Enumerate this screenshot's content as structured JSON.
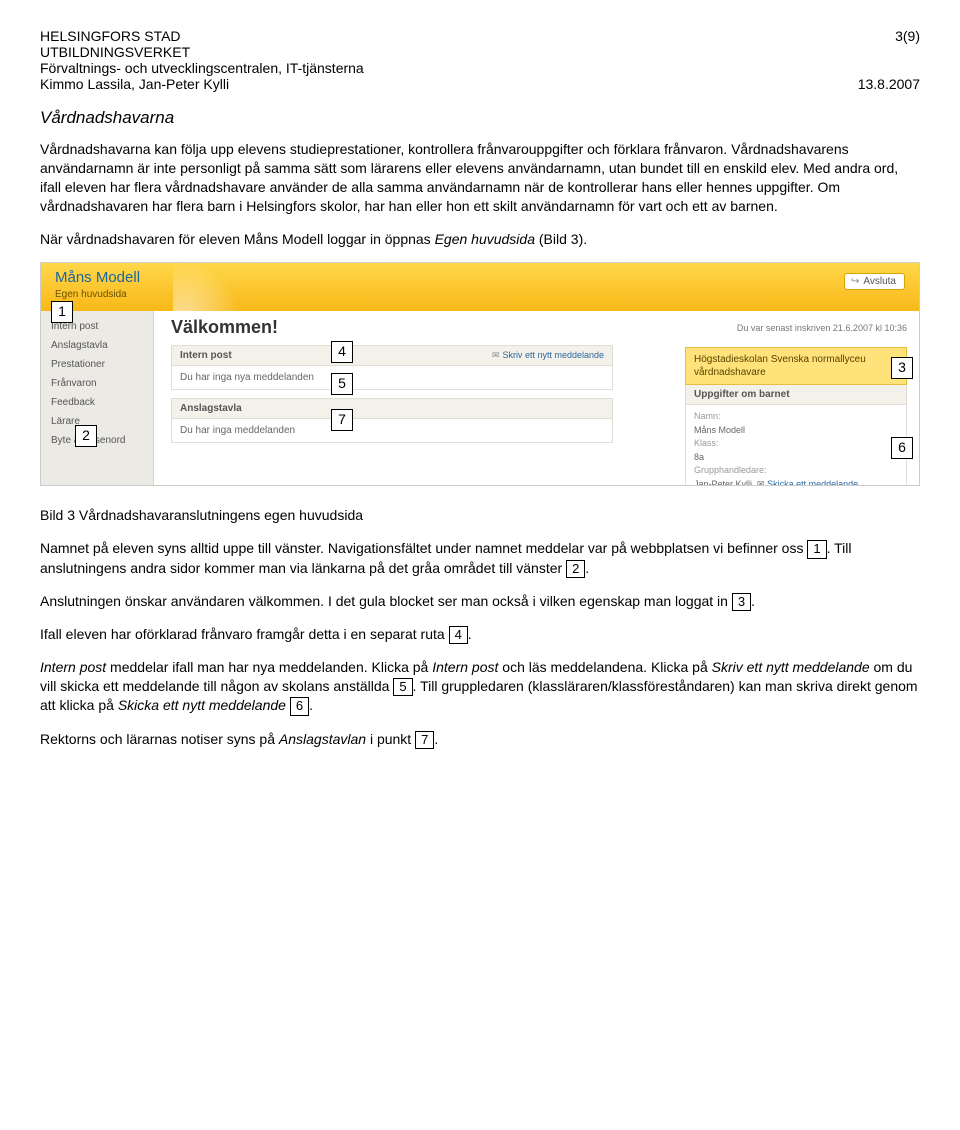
{
  "header": {
    "org1": "HELSINGFORS STAD",
    "org2": "UTBILDNINGSVERKET",
    "org3": "Förvaltnings- och utvecklingscentralen, IT-tjänsterna",
    "authors": "Kimmo Lassila, Jan-Peter Kylli",
    "page": "3(9)",
    "date": "13.8.2007"
  },
  "title": "Vårdnadshavarna",
  "para1a": "Vårdnadshavarna kan följa upp elevens studieprestationer, kontrollera frånvarouppgifter och förklara frånvaron. Vårdnadshavarens användarnamn är inte personligt på samma sätt som lärarens eller elevens användarnamn, utan bundet till en enskild elev. Med andra ord, ifall eleven har flera vårdnadshavare använder de alla samma användarnamn när de kontrollerar hans eller hennes uppgifter. Om vårdnadshavaren har flera barn i Helsingfors skolor, har han eller hon ett skilt användarnamn för vart och ett av barnen.",
  "para2_pre": "När vårdnadshavaren för eleven Måns Modell loggar in öppnas ",
  "para2_em": "Egen huvudsida",
  "para2_post": " (Bild 3).",
  "shot": {
    "name": "Måns Modell",
    "breadcrumb": "Egen huvudsida",
    "avsluta": "Avsluta",
    "welcome": "Välkommen!",
    "lastlogin": "Du var senast inskriven 21.6.2007 kl 10:36",
    "nav": [
      "Intern post",
      "Anslagstavla",
      "Prestationer",
      "Frånvaron",
      "Feedback",
      "Lärare",
      "Byte av lösenord"
    ],
    "mid": {
      "p1_title": "Intern post",
      "p1_link": "Skriv ett nytt meddelande",
      "p1_row": "Du har inga nya meddelanden",
      "p2_title": "Anslagstavla",
      "p2_row": "Du har inga meddelanden"
    },
    "right": {
      "role_line1": "Högstadieskolan Svenska normallyceu",
      "role_line2": "vårdnadshavare",
      "info_title": "Uppgifter om barnet",
      "lbl_name": "Namn:",
      "val_name": "Måns Modell",
      "lbl_class": "Klass:",
      "val_class": "8a",
      "lbl_handler": "Grupphandledare:",
      "val_handler": "Jan-Peter Kylli",
      "msg_link": "Skicka ett meddelande"
    }
  },
  "caption": "Bild 3 Vårdnadshavaranslutningens egen huvudsida",
  "p3_a": "Namnet på eleven syns alltid uppe till vänster. Navigationsfältet under namnet meddelar var på webbplatsen vi befinner oss ",
  "p3_b": ". Till anslutningens andra sidor kommer man via länkarna på det gråa området till vänster ",
  "p3_c": ".",
  "p4_a": "Anslutningen önskar användaren välkommen. I det gula blocket ser man också i vilken egenskap man loggat in ",
  "p4_b": ".",
  "p5_a": "Ifall eleven har oförklarad frånvaro framgår detta i en separat ruta ",
  "p5_b": ".",
  "p6_em1": "Intern post",
  "p6_a": " meddelar ifall man har nya meddelanden. Klicka på ",
  "p6_em2": "Intern post",
  "p6_b": " och läs meddelandena. Klicka på ",
  "p6_em3": "Skriv ett nytt meddelande",
  "p6_c": " om du vill skicka ett meddelande till någon av skolans anställda ",
  "p6_d": ". Till gruppledaren (klassläraren/klassföreståndaren) kan man skriva direkt genom att klicka på ",
  "p6_em4": "Skicka ett nytt meddelande",
  "p6_e": " ",
  "p6_f": ".",
  "p7_a": "Rektorns och lärarnas notiser syns på ",
  "p7_em": "Anslagstavlan",
  "p7_b": " i punkt ",
  "p7_c": ".",
  "nums": {
    "n1": "1",
    "n2": "2",
    "n3": "3",
    "n4": "4",
    "n5": "5",
    "n6": "6",
    "n7": "7"
  }
}
